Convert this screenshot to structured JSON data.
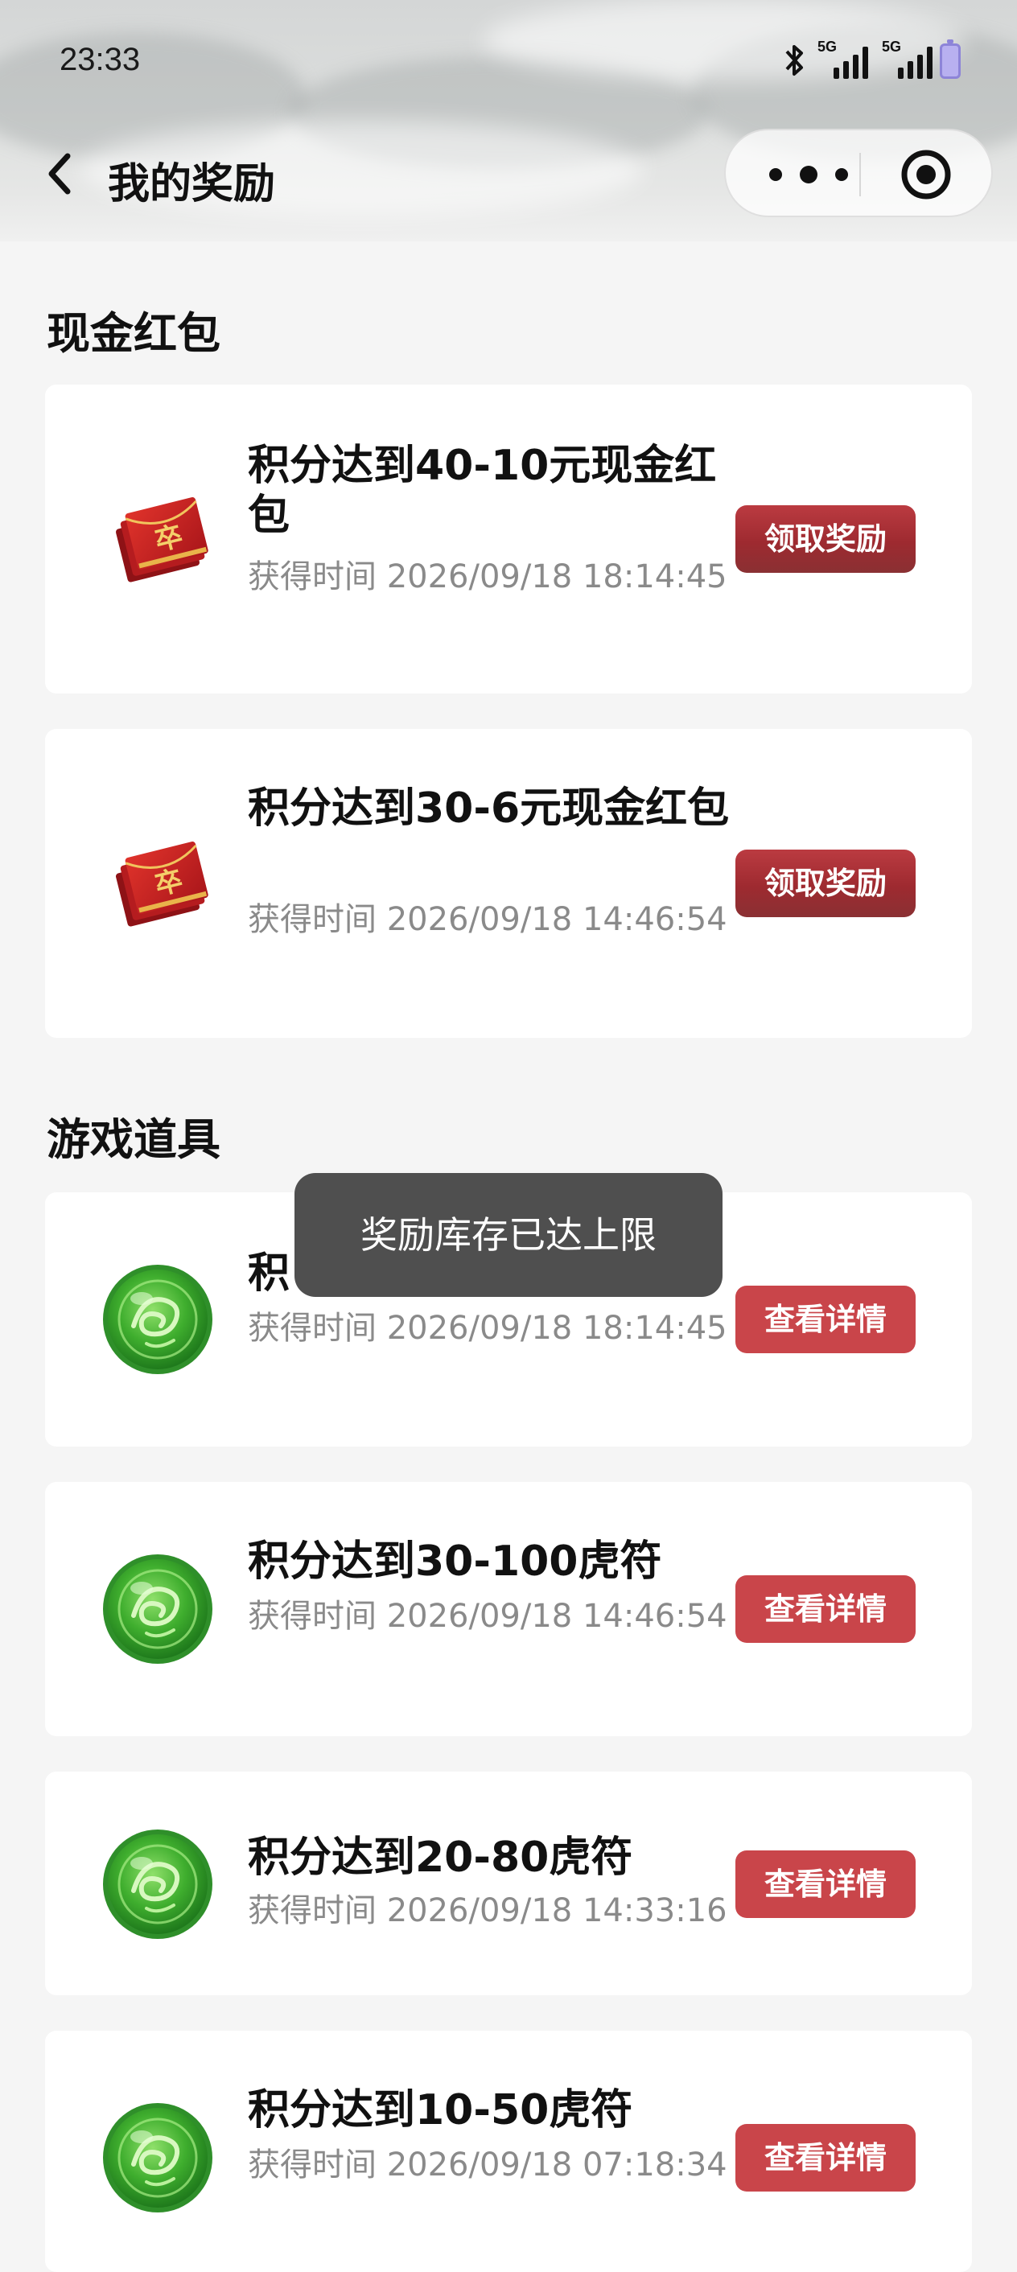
{
  "status_bar": {
    "time": "23:33",
    "signal_label_1": "5G",
    "signal_label_2": "5G",
    "battery_color": "#b8b0f0"
  },
  "nav": {
    "title": "我的奖励",
    "back_icon": "chevron-left-icon",
    "more_icon": "more-dots-icon",
    "close_icon": "target-circle-icon"
  },
  "sections": {
    "cash": {
      "title": "现金红包",
      "items": [
        {
          "title": "积分达到40-10元现金红包",
          "time": "获得时间 2026/09/18 18:14:45",
          "button": "领取奖励",
          "icon": "red-envelope-icon"
        },
        {
          "title": "积分达到30-6元现金红包",
          "time": "获得时间 2026/09/18 14:46:54",
          "button": "领取奖励",
          "icon": "red-envelope-icon"
        }
      ]
    },
    "props": {
      "title": "游戏道具",
      "items": [
        {
          "title": "积",
          "time": "获得时间 2026/09/18 18:14:45",
          "button": "查看详情",
          "icon": "jade-tiger-token-icon"
        },
        {
          "title": "积分达到30-100虎符",
          "time": "获得时间 2026/09/18 14:46:54",
          "button": "查看详情",
          "icon": "jade-tiger-token-icon"
        },
        {
          "title": "积分达到20-80虎符",
          "time": "获得时间 2026/09/18 14:33:16",
          "button": "查看详情",
          "icon": "jade-tiger-token-icon"
        },
        {
          "title": "积分达到10-50虎符",
          "time": "获得时间 2026/09/18 07:18:34",
          "button": "查看详情",
          "icon": "jade-tiger-token-icon"
        }
      ]
    }
  },
  "toast": {
    "message": "奖励库存已达上限"
  },
  "colors": {
    "claim_button": "#a83238",
    "view_button": "#c9454a",
    "page_background": "#f5f5f5",
    "card_background": "#ffffff"
  }
}
